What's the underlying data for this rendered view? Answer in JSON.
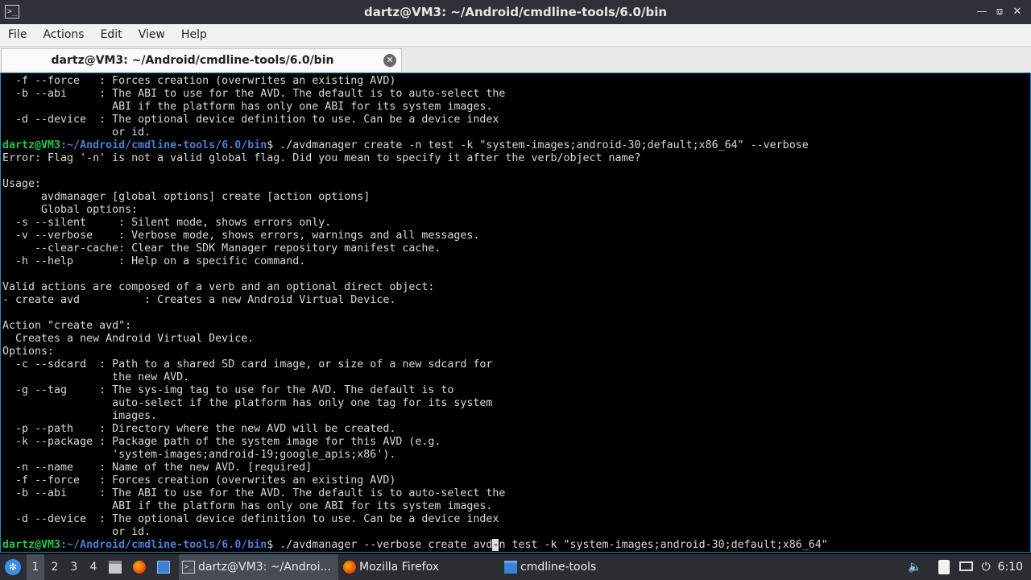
{
  "window": {
    "title": "dartz@VM3: ~/Android/cmdline-tools/6.0/bin",
    "app_icon": "terminal-icon",
    "buttons": [
      "minimize",
      "maximize",
      "close"
    ]
  },
  "menu": [
    "File",
    "Actions",
    "Edit",
    "View",
    "Help"
  ],
  "tab": {
    "label": "dartz@VM3: ~/Android/cmdline-tools/6.0/bin",
    "close_icon": "close-circle-icon"
  },
  "terminal": {
    "prompt_user": "dartz@VM3",
    "prompt_path": ":~/Android/cmdline-tools/6.0/bin",
    "lines": [
      {
        "text": "  -f --force   : Forces creation (overwrites an existing AVD)"
      },
      {
        "text": "  -b --abi     : The ABI to use for the AVD. The default is to auto-select the"
      },
      {
        "text": "                 ABI if the platform has only one ABI for its system images."
      },
      {
        "text": "  -d --device  : The optional device definition to use. Can be a device index"
      },
      {
        "text": "                 or id."
      },
      {
        "prompt": true,
        "text": "$ ./avdmanager create -n test -k \"system-images;android-30;default;x86_64\" --verbose"
      },
      {
        "text": "Error: Flag '-n' is not a valid global flag. Did you mean to specify it after the verb/object name?"
      },
      {
        "text": ""
      },
      {
        "text": "Usage:"
      },
      {
        "text": "      avdmanager [global options] create [action options]"
      },
      {
        "text": "      Global options:"
      },
      {
        "text": "  -s --silent     : Silent mode, shows errors only."
      },
      {
        "text": "  -v --verbose    : Verbose mode, shows errors, warnings and all messages."
      },
      {
        "text": "     --clear-cache: Clear the SDK Manager repository manifest cache."
      },
      {
        "text": "  -h --help       : Help on a specific command."
      },
      {
        "text": ""
      },
      {
        "text": "Valid actions are composed of a verb and an optional direct object:"
      },
      {
        "text": "- create avd          : Creates a new Android Virtual Device."
      },
      {
        "text": ""
      },
      {
        "text": "Action \"create avd\":"
      },
      {
        "text": "  Creates a new Android Virtual Device."
      },
      {
        "text": "Options:"
      },
      {
        "text": "  -c --sdcard  : Path to a shared SD card image, or size of a new sdcard for"
      },
      {
        "text": "                 the new AVD."
      },
      {
        "text": "  -g --tag     : The sys-img tag to use for the AVD. The default is to"
      },
      {
        "text": "                 auto-select if the platform has only one tag for its system"
      },
      {
        "text": "                 images."
      },
      {
        "text": "  -p --path    : Directory where the new AVD will be created."
      },
      {
        "text": "  -k --package : Package path of the system image for this AVD (e.g."
      },
      {
        "text": "                 'system-images;android-19;google_apis;x86')."
      },
      {
        "text": "  -n --name    : Name of the new AVD. [required]"
      },
      {
        "text": "  -f --force   : Forces creation (overwrites an existing AVD)"
      },
      {
        "text": "  -b --abi     : The ABI to use for the AVD. The default is to auto-select the"
      },
      {
        "text": "                 ABI if the platform has only one ABI for its system images."
      },
      {
        "text": "  -d --device  : The optional device definition to use. Can be a device index"
      },
      {
        "text": "                 or id."
      },
      {
        "prompt": true,
        "text": "$ ./avdmanager --verbose create avd",
        "cursor_char": "-",
        "after": "n test -k \"system-images;android-30;default;x86_64\""
      }
    ]
  },
  "taskbar": {
    "start_icon": "start-menu-icon",
    "workspaces": [
      "1",
      "2",
      "3",
      "4"
    ],
    "active_workspace": "1",
    "quick_launch": [
      "file-manager-icon",
      "firefox-icon",
      "show-desktop-icon"
    ],
    "tasks": [
      {
        "icon": "terminal-icon",
        "label": "dartz@VM3: ~/Androi...",
        "active": true
      },
      {
        "icon": "firefox-icon",
        "label": "Mozilla Firefox",
        "active": false
      },
      {
        "icon": "folder-icon",
        "label": "cmdline-tools",
        "active": false
      }
    ],
    "tray": [
      "volume-icon",
      "clipboard-icon",
      "display-icon",
      "power-icon"
    ],
    "clock": "6:10"
  }
}
